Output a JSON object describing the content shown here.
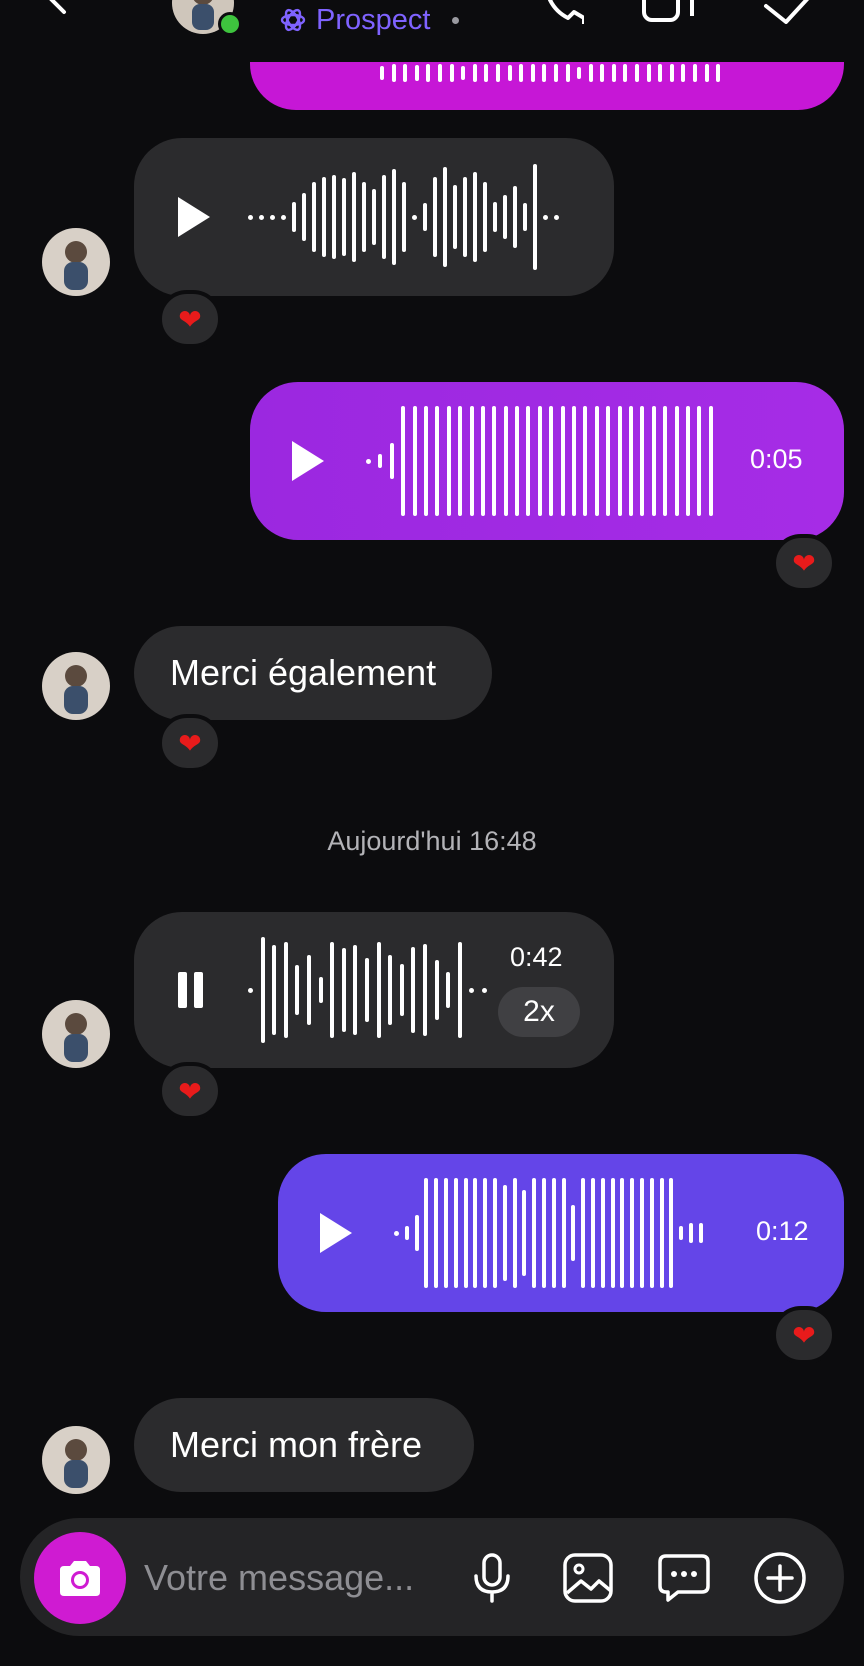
{
  "header": {
    "title": "Prospect"
  },
  "messages": {
    "timestamp": "Aujourd'hui 16:48",
    "sent_voice_1": {
      "duration": "0:05"
    },
    "received_voice_2": {
      "duration": "0:42",
      "speed": "2x"
    },
    "sent_voice_2": {
      "duration": "0:12"
    },
    "received_text_1": "Merci également",
    "received_text_2": "Merci mon frère",
    "reaction": "❤"
  },
  "composer": {
    "placeholder": "Votre message..."
  },
  "colors": {
    "background": "#0c0c0e",
    "received_bubble": "#2b2b2d",
    "sent_magenta": "#c617d6",
    "sent_purple": "#a12ae3",
    "sent_violet": "#6445e8",
    "accent": "#7f63ff",
    "camera_button": "#cf1bd2",
    "online_dot": "#3ec43e"
  },
  "icons": [
    "back-arrow-icon",
    "phone-icon",
    "video-icon",
    "tag-icon",
    "play-icon",
    "pause-icon",
    "camera-icon",
    "microphone-icon",
    "image-icon",
    "chat-bubble-icon",
    "plus-circle-icon",
    "heart-icon"
  ]
}
